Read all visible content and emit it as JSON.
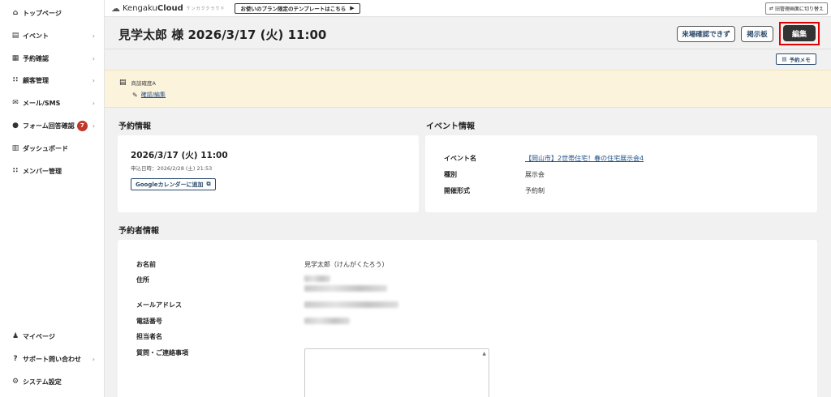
{
  "sidebar": {
    "items": [
      {
        "label": "トップページ",
        "icon": "home-icon",
        "glyph": "⌂",
        "chevron": false
      },
      {
        "label": "イベント",
        "icon": "document-icon",
        "glyph": "▤",
        "chevron": true
      },
      {
        "label": "予約確認",
        "icon": "calendar-icon",
        "glyph": "▦",
        "chevron": true
      },
      {
        "label": "顧客管理",
        "icon": "users-icon",
        "glyph": "∷",
        "chevron": true
      },
      {
        "label": "メール/SMS",
        "icon": "mail-icon",
        "glyph": "✉",
        "chevron": true
      },
      {
        "label": "フォーム回答確認",
        "icon": "chat-icon",
        "glyph": "●",
        "chevron": true,
        "badge": "7"
      },
      {
        "label": "ダッシュボード",
        "icon": "chart-icon",
        "glyph": "▥",
        "chevron": false
      },
      {
        "label": "メンバー管理",
        "icon": "grid-icon",
        "glyph": "∷",
        "chevron": false
      }
    ],
    "bottom_items": [
      {
        "label": "マイページ",
        "icon": "person-icon",
        "glyph": "♟",
        "chevron": false
      },
      {
        "label": "サポート問い合わせ",
        "icon": "help-icon",
        "glyph": "?",
        "chevron": true
      },
      {
        "label": "システム設定",
        "icon": "gear-icon",
        "glyph": "⚙",
        "chevron": false
      }
    ]
  },
  "topbar": {
    "logo_prefix": "Kengaku",
    "logo_brand": "Cloud",
    "logo_sub": "ケンガククラウド",
    "template_button": "お使いのプラン限定のテンプレートはこちら",
    "switch_button": "旧管理画面に切り替え"
  },
  "header": {
    "title": "見学太郎 様 2026/3/17 (火) 11:00",
    "arrival_button": "来場確認できず",
    "board_button": "掲示板",
    "edit_button": "編集",
    "memo_button": "予約メモ"
  },
  "banner": {
    "doc_label": "商談確度A",
    "link_label": "確認/編集"
  },
  "reservation": {
    "section_title": "予約情報",
    "datetime": "2026/3/17 (火) 11:00",
    "applied": "申込日時：2026/2/28 (土) 21:53",
    "gcal_button": "Googleカレンダーに追加"
  },
  "event": {
    "section_title": "イベント情報",
    "name_label": "イベント名",
    "name_value": "【岡山市】2世帯住宅！春の住宅展示会4",
    "type_label": "種別",
    "type_value": "展示会",
    "format_label": "開催形式",
    "format_value": "予約制"
  },
  "booker": {
    "section_title": "予約者情報",
    "name_label": "お名前",
    "name_value": "見学太郎（けんがくたろう）",
    "address_label": "住所",
    "email_label": "メールアドレス",
    "phone_label": "電話番号",
    "staff_label": "担当者名",
    "question_label": "質問・ご連絡事項"
  }
}
